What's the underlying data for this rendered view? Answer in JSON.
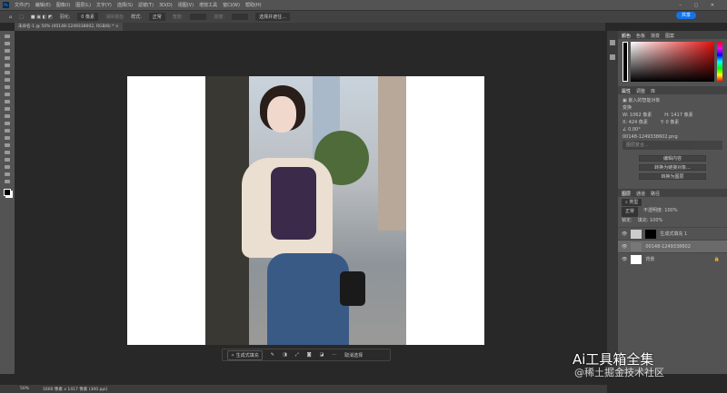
{
  "menu": [
    "文件(F)",
    "编辑(E)",
    "图像(I)",
    "图层(L)",
    "文字(Y)",
    "选择(S)",
    "滤镜(T)",
    "3D(D)",
    "视图(V)",
    "增效工具",
    "窗口(W)",
    "帮助(H)"
  ],
  "options": {
    "feather_label": "羽化:",
    "feather_value": "0 像素",
    "antialias": "消除锯齿",
    "style_label": "样式:",
    "style_value": "正常",
    "width_label": "宽度:",
    "height_label": "高度:",
    "select_mask": "选择并遮住..."
  },
  "share": "共享",
  "doc_tab": "未命名-1 @ 50% (00148-1249338602, RGB/8) *",
  "color_panel": {
    "tabs": [
      "颜色",
      "色板",
      "渐变",
      "图案"
    ]
  },
  "properties": {
    "tabs": [
      "属性",
      "调整",
      "库"
    ],
    "type": "嵌入的智能对象",
    "transform": "变换",
    "w": "W: 1062 像素",
    "h": "H: 1417 像素",
    "x": "X: 424 像素",
    "y": "Y: 0 像素",
    "angle": "∠ 0.00°",
    "filename": "00148-1249338602.png",
    "comp": "图层复合...",
    "buttons": [
      "编辑内容",
      "转换为链接对象...",
      "转换为图层"
    ]
  },
  "layers": {
    "tabs": [
      "图层",
      "通道",
      "路径"
    ],
    "filter": "类型",
    "blend": "正常",
    "opacity": "不透明度: 100%",
    "lock": "锁定:",
    "fill": "填充: 100%",
    "items": [
      "生成式填充 1",
      "00148-1249338602",
      "背景"
    ]
  },
  "taskbar": {
    "generate": "生成式填充",
    "deselect": "取消选择"
  },
  "status": {
    "zoom": "50%",
    "size": "1600 像素 x 1417 像素 (300 ppi)"
  },
  "watermark": {
    "title": "Ai工具箱全集",
    "sub": "@稀土掘金技术社区"
  }
}
